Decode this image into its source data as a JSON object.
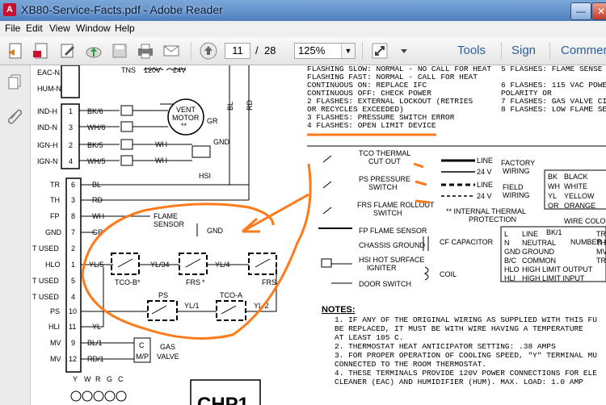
{
  "window": {
    "title": "XB80-Service-Facts.pdf - Adobe Reader",
    "app_icon_letter": "A",
    "minimize_glyph": "—",
    "close_glyph": "✕"
  },
  "menu": {
    "items": [
      "File",
      "Edit",
      "View",
      "Window",
      "Help"
    ]
  },
  "toolbar": {
    "page_current": "11",
    "page_separator": "/",
    "page_total": "28",
    "zoom": "125%",
    "zoom_arrow": "▼",
    "tools_label": "Tools",
    "sign_label": "Sign",
    "comment_label": "Commer"
  },
  "icons": {
    "create": "create-pdf-icon",
    "edit": "edit-pdf-icon",
    "sign": "fill-sign-icon",
    "upload": "upload-cloud-icon",
    "save": "save-icon",
    "print": "print-icon",
    "email": "email-icon",
    "prev_page": "previous-page-icon",
    "fit": "fit-page-icon",
    "pages_panel": "pages-panel-icon",
    "attach_panel": "attachment-paperclip-icon"
  },
  "colors": {
    "title_bar": "#5a8ac6",
    "accent_link": "#2b5f9c",
    "annotation_orange": "#ff7a1a"
  },
  "document": {
    "left_labels": [
      "EAC-N",
      "HUM-N",
      "IND-H",
      "IND-N",
      "IGN-H",
      "IGN-N",
      "TR",
      "TH",
      "FP",
      "GND",
      "T USED",
      "HLO",
      "T USED",
      "T USED",
      "PS",
      "HLI",
      "MV",
      "MV"
    ],
    "pin_numbers": [
      "1",
      "3",
      "2",
      "4",
      "6",
      "3",
      "8",
      "7",
      "1",
      "5",
      "4",
      "2",
      "10",
      "11",
      "9",
      "12"
    ],
    "wire_labels": [
      "BK/6",
      "WH/6",
      "BK/5",
      "WH/5",
      "BL",
      "RD",
      "WH",
      "GR",
      "YL/5",
      "YL",
      "BL/1",
      "RD/1"
    ],
    "top_component_labels": [
      "TNS",
      "120V",
      "24V",
      "VENT",
      "MOTOR",
      "**",
      "GR",
      "GND",
      "BL",
      "RD",
      "WH",
      "WH",
      "HSI"
    ],
    "legend_lines": [
      "FLASHING SLOW: NORMAL - NO CALL FOR HEAT",
      "FLASHING FAST: NORMAL - CALL FOR HEAT",
      "CONTINUOUS ON: REPLACE IFC",
      "CONTINUOUS OFF: CHECK POWER",
      "2 FLASHES: EXTERNAL LOCKOUT (RETRIES",
      "           OR RECYCLES EXCEEDED)",
      "3 FLASHES: PRESSURE SWITCH ERROR",
      "4 FLASHES: OPEN LIMIT DEVICE"
    ],
    "legend_right": [
      "5 FLASHES: FLAME SENSE",
      "6 FLASHES: 115 VAC POWE",
      "           POLARITY OR",
      "7 FLASHES: GAS VALVE CI",
      "8 FLASHES: LOW FLAME SEN"
    ],
    "symbol_legend": [
      {
        "label": "TCO THERMAL",
        "label2": "CUT OUT"
      },
      {
        "label": "PS PRESSURE",
        "label2": "SWITCH"
      },
      {
        "label": "FRS FLAME ROLLOUT",
        "label2": "SWITCH"
      },
      {
        "label": "FP FLAME SENSOR"
      },
      {
        "label": "CHASSIS GROUND"
      },
      {
        "label": "HSI HOT SURFACE",
        "label2": "IGNITER"
      },
      {
        "label": "DOOR SWITCH"
      }
    ],
    "wiring_legend": {
      "line1": "LINE",
      "v24a": "24 V",
      "factory": "FACTORY",
      "wiring1": "WIRING",
      "line2": "LINE",
      "v24b": "24 V",
      "field": "FIELD",
      "wiring2": "WIRING",
      "internal": "** INTERNAL THERMAL",
      "protection": "PROTECTION",
      "cf": "CF CAPACITOR",
      "coil": "COIL"
    },
    "color_codes": [
      {
        "code": "BK",
        "name": "BLACK"
      },
      {
        "code": "WH",
        "name": "WHITE"
      },
      {
        "code": "YL",
        "name": "YELLOW"
      },
      {
        "code": "OR",
        "name": "ORANGE"
      }
    ],
    "wire_color_label": "WIRE COLOR",
    "bk_label": "BK/1",
    "number_id": "NUMBER ID",
    "abbrev": [
      {
        "code": "L",
        "name": "LINE"
      },
      {
        "code": "N",
        "name": "NEUTRAL"
      },
      {
        "code": "GND",
        "name": "GROUND"
      },
      {
        "code": "B/C",
        "name": "COMMON"
      },
      {
        "code": "HLO",
        "name": "HIGH LIMIT OUTPUT"
      },
      {
        "code": "HLI",
        "name": "HIGH LIMIT INPUT"
      }
    ],
    "abbrev_right": [
      "TR",
      "TH",
      "MV",
      "TR"
    ],
    "circled_labels": {
      "flame": "FLAME",
      "sensor": "SENSOR",
      "gnd": "GND",
      "yl34": "YL/34",
      "yl4": "YL/4",
      "tcob": "TCO-B",
      "frs1": "FRS",
      "frs2": "FRS",
      "ps": "PS",
      "tcoa": "TCO-A",
      "yl1": "YL/1",
      "yl2": "YL/2",
      "gas": "GAS",
      "valve": "VALVE",
      "c": "C",
      "mp": "M/P",
      "star": "*"
    },
    "terminal_letters": [
      "Y",
      "W",
      "R",
      "G",
      "C"
    ],
    "notes_title": "NOTES:",
    "notes": [
      "1.  IF ANY OF THE ORIGINAL WIRING AS SUPPLIED WITH THIS FU",
      "    BE REPLACED, IT MUST BE WITH WIRE HAVING A TEMPERATURE",
      "    AT LEAST 105 C.",
      "2.  THERMOSTAT HEAT ANTICIPATOR SETTING: .38 AMPS",
      "3.  FOR PROPER OPERATION OF COOLING SPEED, \"Y\" TERMINAL MU",
      "    CONNECTED TO THE ROOM THERMOSTAT.",
      "4.  THESE TERMINALS PROVIDE 120V POWER CONNECTIONS FOR ELE",
      "    CLEANER (EAC) AND HUMIDIFIER (HUM). MAX. LOAD: 1.0 AMP"
    ],
    "bottom_box_text": "CHP1"
  }
}
